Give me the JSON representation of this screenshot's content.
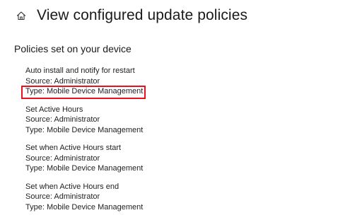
{
  "header": {
    "icon": "home-icon",
    "title": "View configured update policies"
  },
  "section": {
    "title": "Policies set on your device"
  },
  "policies": [
    {
      "name": "Auto install and notify for restart",
      "source": "Source: Administrator",
      "type": "Type: Mobile Device Management"
    },
    {
      "name": "Set Active Hours",
      "source": "Source: Administrator",
      "type": "Type: Mobile Device Management"
    },
    {
      "name": "Set when Active Hours start",
      "source": "Source: Administrator",
      "type": "Type: Mobile Device Management"
    },
    {
      "name": "Set when Active Hours end",
      "source": "Source: Administrator",
      "type": "Type: Mobile Device Management"
    }
  ],
  "highlight": {
    "color": "#e8121f"
  }
}
